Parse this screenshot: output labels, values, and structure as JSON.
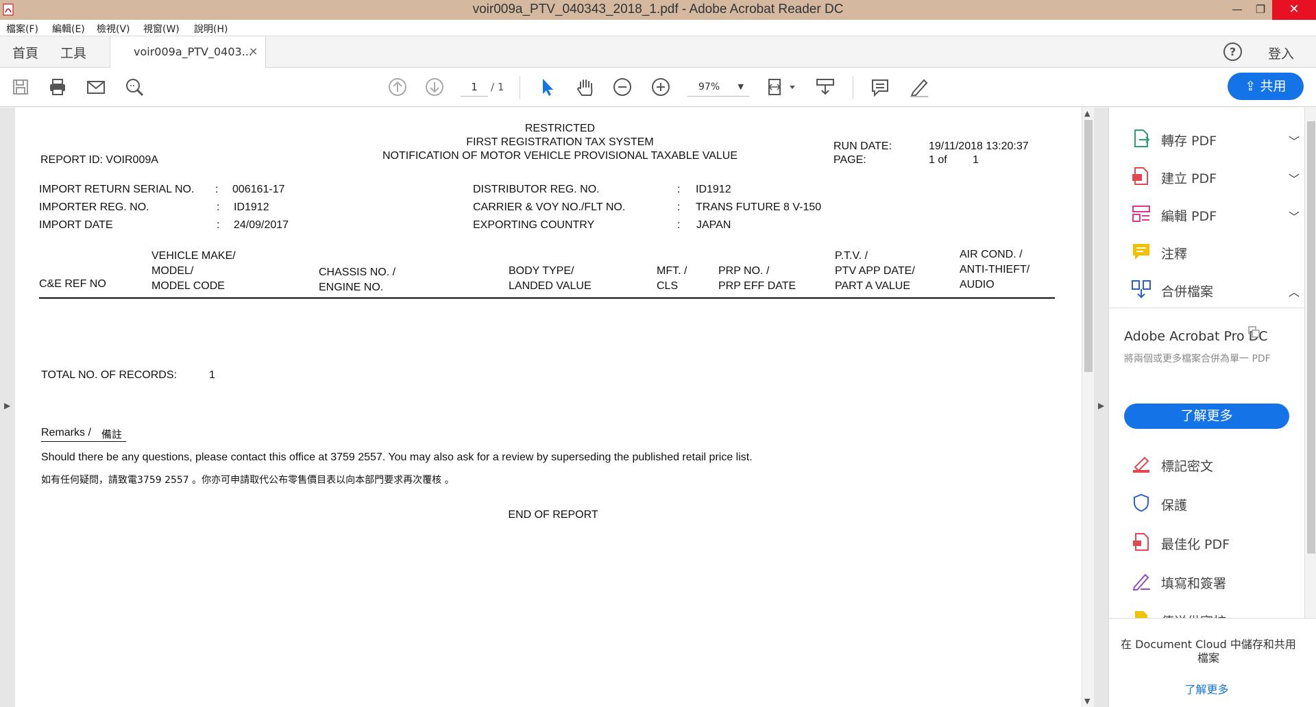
{
  "window": {
    "title": "voir009a_PTV_040343_2018_1.pdf - Adobe Acrobat Reader DC",
    "minimize": "—",
    "maximize": "❐",
    "close": "✕"
  },
  "menu": [
    "檔案(F)",
    "編輯(E)",
    "檢視(V)",
    "視窗(W)",
    "說明(H)"
  ],
  "tabs": {
    "home": "首頁",
    "tools": "工具",
    "document": "voir009a_PTV_0403...",
    "close": "×",
    "help": "?",
    "login": "登入"
  },
  "toolbar": {
    "page_current": "1",
    "page_total": "/ 1",
    "zoom": "97%",
    "share": "共用"
  },
  "report": {
    "restricted": "RESTRICTED",
    "system": "FIRST REGISTRATION TAX SYSTEM",
    "notification": "NOTIFICATION OF MOTOR VEHICLE PROVISIONAL TAXABLE VALUE",
    "report_id": "REPORT ID: VOIR009A",
    "run_date_label": "RUN DATE:",
    "run_date_value": "19/11/2018 13:20:37",
    "page_label": "PAGE:",
    "page_value_a": "1 of",
    "page_value_b": "1",
    "fields_left": [
      {
        "label": "IMPORT RETURN SERIAL NO.",
        "sep": ":",
        "value": "006161-17"
      },
      {
        "label": "IMPORTER REG. NO.",
        "sep": ":",
        "value": "ID1912"
      },
      {
        "label": "IMPORT DATE",
        "sep": ":",
        "value": "24/09/2017"
      }
    ],
    "fields_right": [
      {
        "label": "DISTRIBUTOR REG. NO.",
        "sep": ":",
        "value": "ID1912"
      },
      {
        "label": "CARRIER & VOY NO./FLT NO.",
        "sep": ":",
        "value": "TRANS FUTURE 8 V-150"
      },
      {
        "label": "EXPORTING COUNTRY",
        "sep": ":",
        "value": "JAPAN"
      }
    ],
    "columns": {
      "c1": "C&E REF NO",
      "c2a": "VEHICLE MAKE/",
      "c2b": "MODEL/",
      "c2c": "MODEL CODE",
      "c3a": "CHASSIS NO. /",
      "c3b": "ENGINE NO.",
      "c4a": "BODY TYPE/",
      "c4b": "LANDED VALUE",
      "c5a": "MFT. /",
      "c5b": "CLS",
      "c6a": "PRP NO. /",
      "c6b": "PRP EFF DATE",
      "c7a": "P.T.V. /",
      "c7b": "PTV APP DATE/",
      "c7c": "PART A VALUE",
      "c8a": "AIR COND.  /",
      "c8b": "ANTI-THIEFT/",
      "c8c": "AUDIO"
    },
    "total_label": "TOTAL NO. OF RECORDS:",
    "total_value": "1",
    "remarks_en": "Remarks /",
    "remarks_zh": "備註",
    "remark_line_en": "Should there be any questions, please contact this office at 3759 2557.  You may also ask for a review by superseding the published retail price list.",
    "remark_line_zh": "如有任何疑問，請致電3759 2557 。你亦可申請取代公布零售價目表以向本部門要求再次覆核 。",
    "end": "END OF REPORT"
  },
  "right_panel": {
    "tools": [
      {
        "label": "轉存 PDF",
        "chevron": "⌄",
        "color": "#2d9d78"
      },
      {
        "label": "建立 PDF",
        "chevron": "⌄",
        "color": "#e34850"
      },
      {
        "label": "編輯 PDF",
        "chevron": "⌄",
        "color": "#d83790"
      },
      {
        "label": "注釋",
        "chevron": "",
        "color": "#f2c200"
      },
      {
        "label": "合併檔案",
        "chevron": "⌃",
        "color": "#2b5fcc"
      }
    ],
    "promo_title": "Adobe Acrobat Pro DC",
    "promo_desc": "將兩個或更多檔案合併為單一 PDF",
    "promo_button": "了解更多",
    "tools2": [
      {
        "label": "標記密文",
        "color": "#e34850"
      },
      {
        "label": "保護",
        "color": "#2b5fcc"
      },
      {
        "label": "最佳化 PDF",
        "color": "#e34850"
      },
      {
        "label": "填寫和簽署",
        "color": "#8e4ec6"
      },
      {
        "label": "傳送供審核",
        "color": "#f2c200"
      }
    ],
    "cloud_message": "在 Document Cloud 中儲存和共用檔案",
    "cloud_link": "了解更多"
  }
}
